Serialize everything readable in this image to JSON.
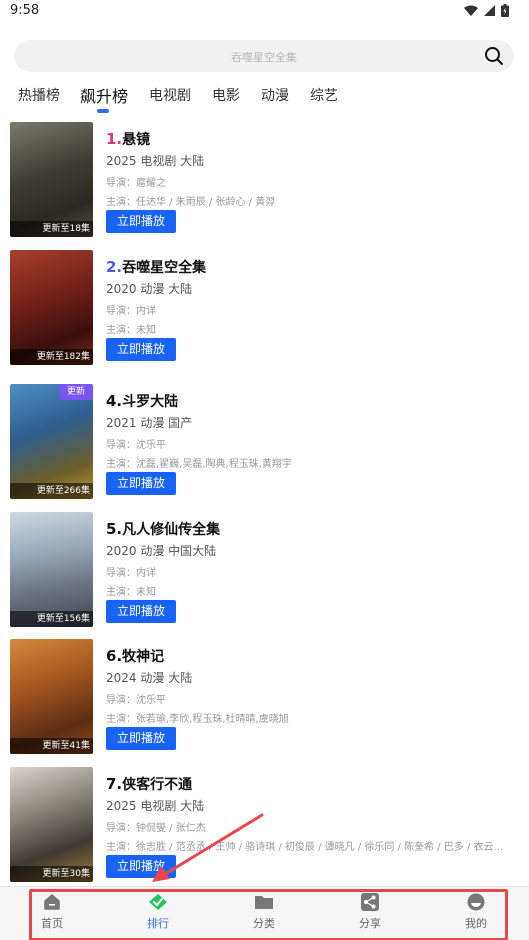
{
  "status": {
    "time": "9:58"
  },
  "search": {
    "placeholder": "吞噬星空全集"
  },
  "tabs": [
    "热播榜",
    "飙升榜",
    "电视剧",
    "电影",
    "动漫",
    "综艺"
  ],
  "items": [
    {
      "rank": "1.",
      "name": "悬镜",
      "meta": "2025  电视剧  大陆",
      "director": "导演：扈耀之",
      "cast": "主演：任达华 / 朱雨辰 / 张龄心 / 黄羿",
      "update": "更新至18集",
      "badge": "",
      "button": "立即播放",
      "rank_color": "#e0337a"
    },
    {
      "rank": "2.",
      "name": "吞噬星空全集",
      "meta": "2020  动漫  大陆",
      "director": "导演：内详",
      "cast": "主演：未知",
      "update": "更新至182集",
      "badge": "",
      "button": "立即播放",
      "rank_color": "#4b57e8"
    },
    {
      "rank": "4.",
      "name": "斗罗大陆",
      "meta": "2021  动漫  国产",
      "director": "导演：沈乐平",
      "cast": "主演：沈磊,翟巍,吴磊,陶典,程玉珠,黄翔宇",
      "update": "更新至266集",
      "badge": "更新",
      "button": "立即播放",
      "rank_color": "#111111"
    },
    {
      "rank": "5.",
      "name": "凡人修仙传全集",
      "meta": "2020  动漫  中国大陆",
      "director": "导演：内详",
      "cast": "主演：未知",
      "update": "更新至156集",
      "badge": "",
      "button": "立即播放",
      "rank_color": "#111111"
    },
    {
      "rank": "6.",
      "name": "牧神记",
      "meta": "2024  动漫  大陆",
      "director": "导演：沈乐平",
      "cast": "主演：张若瑜,李欣,程玉珠,杜晴晴,虞晓旭",
      "update": "更新至41集",
      "badge": "",
      "button": "立即播放",
      "rank_color": "#111111"
    },
    {
      "rank": "7.",
      "name": "侠客行不通",
      "meta": "2025  电视剧  大陆",
      "director": "导演：钟侃燮 / 张仁杰",
      "cast": "主演：徐志胜 / 范丞丞 / 王帅 / 骆诗琪 / 初俊辰 / 谭晓凡 / 徐乐同 / 陈奎希 / 巴多 / 衣云...",
      "update": "更新至30集",
      "badge": "",
      "button": "立即播放",
      "rank_color": "#111111"
    }
  ],
  "nav": [
    {
      "label": "首页",
      "icon": "home-icon"
    },
    {
      "label": "排行",
      "icon": "ranking-icon"
    },
    {
      "label": "分类",
      "icon": "folder-icon"
    },
    {
      "label": "分享",
      "icon": "share-icon"
    },
    {
      "label": "我的",
      "icon": "profile-icon"
    }
  ],
  "colors": {
    "accent": "#1763f5",
    "active_tab_indicator": "#2f6ff2",
    "annotation": "#e8474c"
  }
}
